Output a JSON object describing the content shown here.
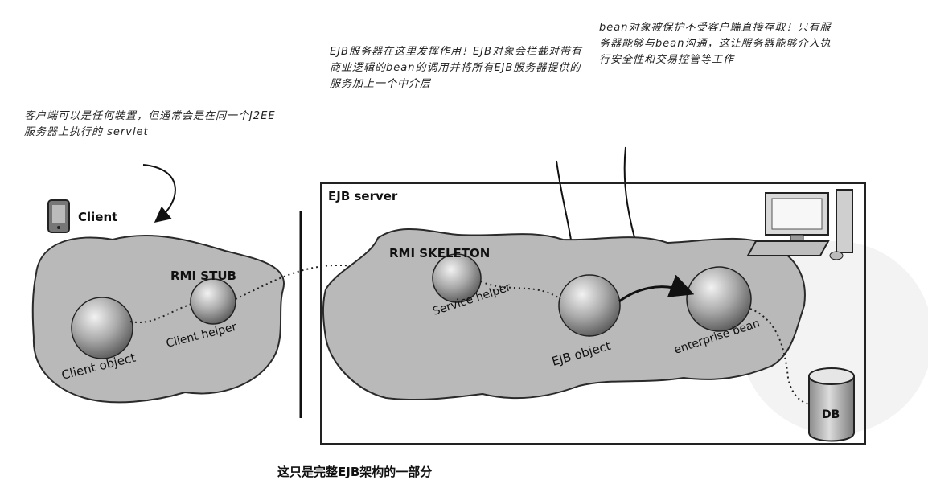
{
  "annotations": {
    "client_note": "客户端可以是任何装置，但通常会是在同一个J2EE服务器上执行的 servlet",
    "ejb_server_note": "EJB服务器在这里发挥作用！EJB对象会拦截对带有商业逻辑的bean的调用并将所有EJB服务器提供的服务加上一个中介层",
    "bean_note": "bean对象被保护不受客户端直接存取！只有服务器能够与bean沟通，这让服务器能够介入执行安全性和交易控管等工作"
  },
  "client": {
    "title": "Client",
    "stub_label": "RMI STUB",
    "object_label": "Client object",
    "helper_label": "Client helper"
  },
  "server": {
    "title": "EJB server",
    "skeleton_label": "RMI SKELETON",
    "service_helper_label": "Service helper",
    "ejb_object_label": "EJB object",
    "bean_label": "enterprise bean",
    "db_label": "DB"
  },
  "caption": "这只是完整EJB架构的一部分",
  "colors": {
    "blob_fill": "#b9b9b9",
    "blob_stroke": "#2a2a2a",
    "sphere_light": "#e8e8e8",
    "sphere_dark": "#6f6f6f"
  }
}
